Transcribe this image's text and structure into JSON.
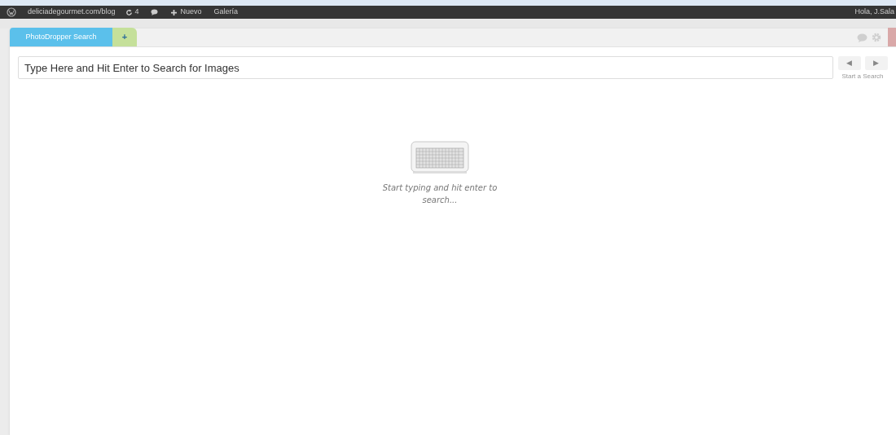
{
  "admin_bar": {
    "site": "deliciadegourmet.com/blog",
    "updates": "4",
    "new": "Nuevo",
    "gallery": "Galería",
    "greeting": "Hola, J.Sala"
  },
  "tabs": [
    {
      "label": "PhotoDropper Search",
      "kind": "tab",
      "selected": true
    },
    {
      "label": "+",
      "kind": "add",
      "selected": false
    }
  ],
  "search": {
    "placeholder": "Type Here and Hit Enter to Search for Images"
  },
  "nav": {
    "prev": "◀",
    "next": "▶",
    "hint": "Start a Search"
  },
  "empty_state": {
    "message": "Start typing and hit enter to search..."
  }
}
